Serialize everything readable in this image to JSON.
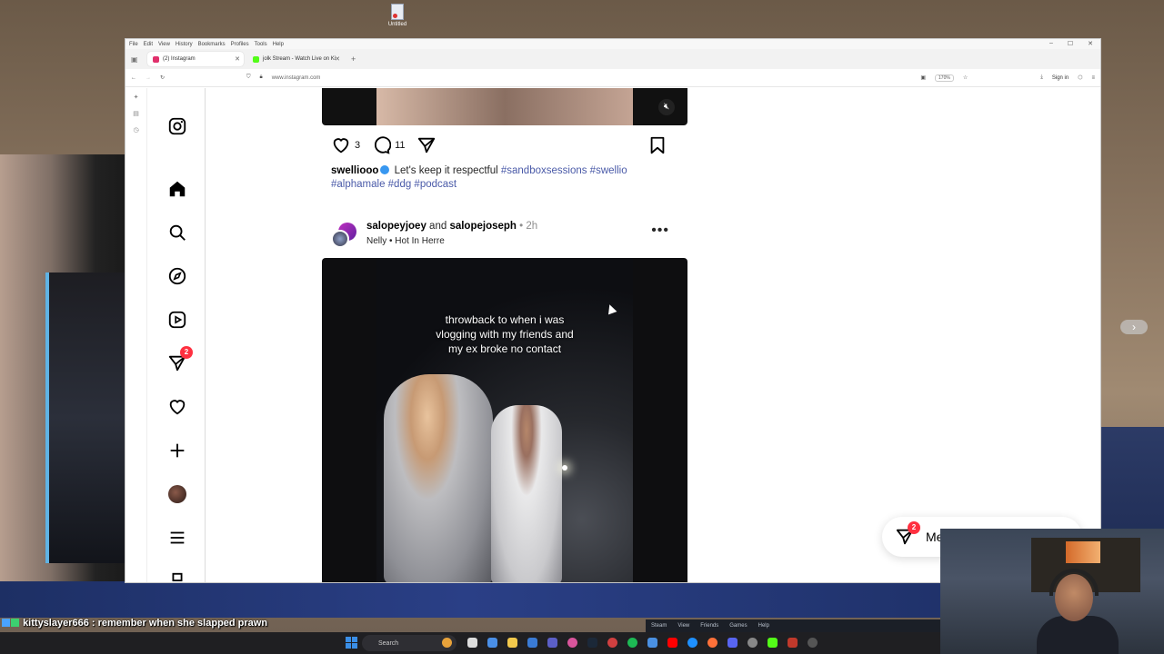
{
  "desktop": {
    "icon_label": "Untitled"
  },
  "browser": {
    "menu": [
      "File",
      "Edit",
      "View",
      "History",
      "Bookmarks",
      "Profiles",
      "Tools",
      "Help"
    ],
    "tabs": [
      {
        "label": "(2) Instagram",
        "color": "#e1306c"
      },
      {
        "label": "jolk Stream - Watch Live on Ki",
        "color": "#53fc18"
      }
    ],
    "url": "www.instagram.com",
    "zoom": "170%",
    "signin": "Sign in"
  },
  "instagram": {
    "nav_badge": "2",
    "prev_post": {
      "likes": "3",
      "comments": "11",
      "caption_user": "swelliooo",
      "caption_text": "Let's keep it respectful",
      "tags": "#sandboxsessions #swellio",
      "tags2": "#alphamale #ddg #podcast"
    },
    "post": {
      "user1": "salopeyjoey",
      "and": "and",
      "user2": "salopejoseph",
      "time": "2h",
      "music_artist": "Nelly",
      "music_track": "Hot In Herre",
      "overlay_line1": "throwback to when i was",
      "overlay_line2": "vlogging with my friends and",
      "overlay_line3": "my ex broke no contact"
    },
    "messages": {
      "label": "Me",
      "badge": "2"
    }
  },
  "chat": [
    {
      "user": "kittyslayer666",
      "text": "remember when she slapped prawn"
    },
    {
      "user": "kittyslayer666",
      "text": ""
    }
  ],
  "steam": {
    "items": [
      "Steam",
      "View",
      "Friends",
      "Games",
      "Help"
    ]
  },
  "taskbar": {
    "search_placeholder": "Search"
  }
}
